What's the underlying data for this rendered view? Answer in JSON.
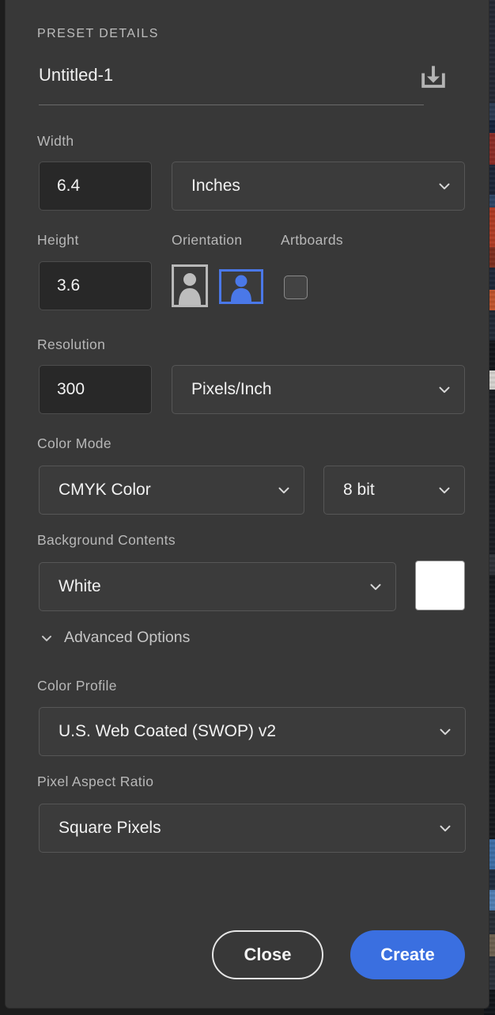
{
  "dialog": {
    "section_title": "PRESET DETAILS",
    "preset_name": "Untitled-1",
    "save_preset_icon": "save-preset-download-icon"
  },
  "width": {
    "label": "Width",
    "value": "6.4",
    "unit": "Inches"
  },
  "height": {
    "label": "Height",
    "value": "3.6"
  },
  "orientation": {
    "label": "Orientation",
    "portrait_icon": "portrait-orientation-icon",
    "landscape_icon": "landscape-orientation-icon",
    "selected": "landscape"
  },
  "artboards": {
    "label": "Artboards",
    "checked": false
  },
  "resolution": {
    "label": "Resolution",
    "value": "300",
    "unit": "Pixels/Inch"
  },
  "color_mode": {
    "label": "Color Mode",
    "value": "CMYK Color",
    "bit_depth": "8 bit"
  },
  "background_contents": {
    "label": "Background Contents",
    "value": "White",
    "swatch_color": "#ffffff"
  },
  "advanced": {
    "label": "Advanced Options",
    "expanded": true,
    "chevron_icon": "chevron-down-icon",
    "color_profile": {
      "label": "Color Profile",
      "value": "U.S. Web Coated (SWOP) v2"
    },
    "pixel_aspect_ratio": {
      "label": "Pixel Aspect Ratio",
      "value": "Square Pixels"
    }
  },
  "footer": {
    "close_label": "Close",
    "create_label": "Create",
    "create_color": "#3a6fe0"
  },
  "theme": {
    "panel_bg": "#383838",
    "input_bg": "#282828",
    "text": "#f2f2f2",
    "label_text": "#b8b8b8",
    "accent": "#3a6fe0"
  }
}
